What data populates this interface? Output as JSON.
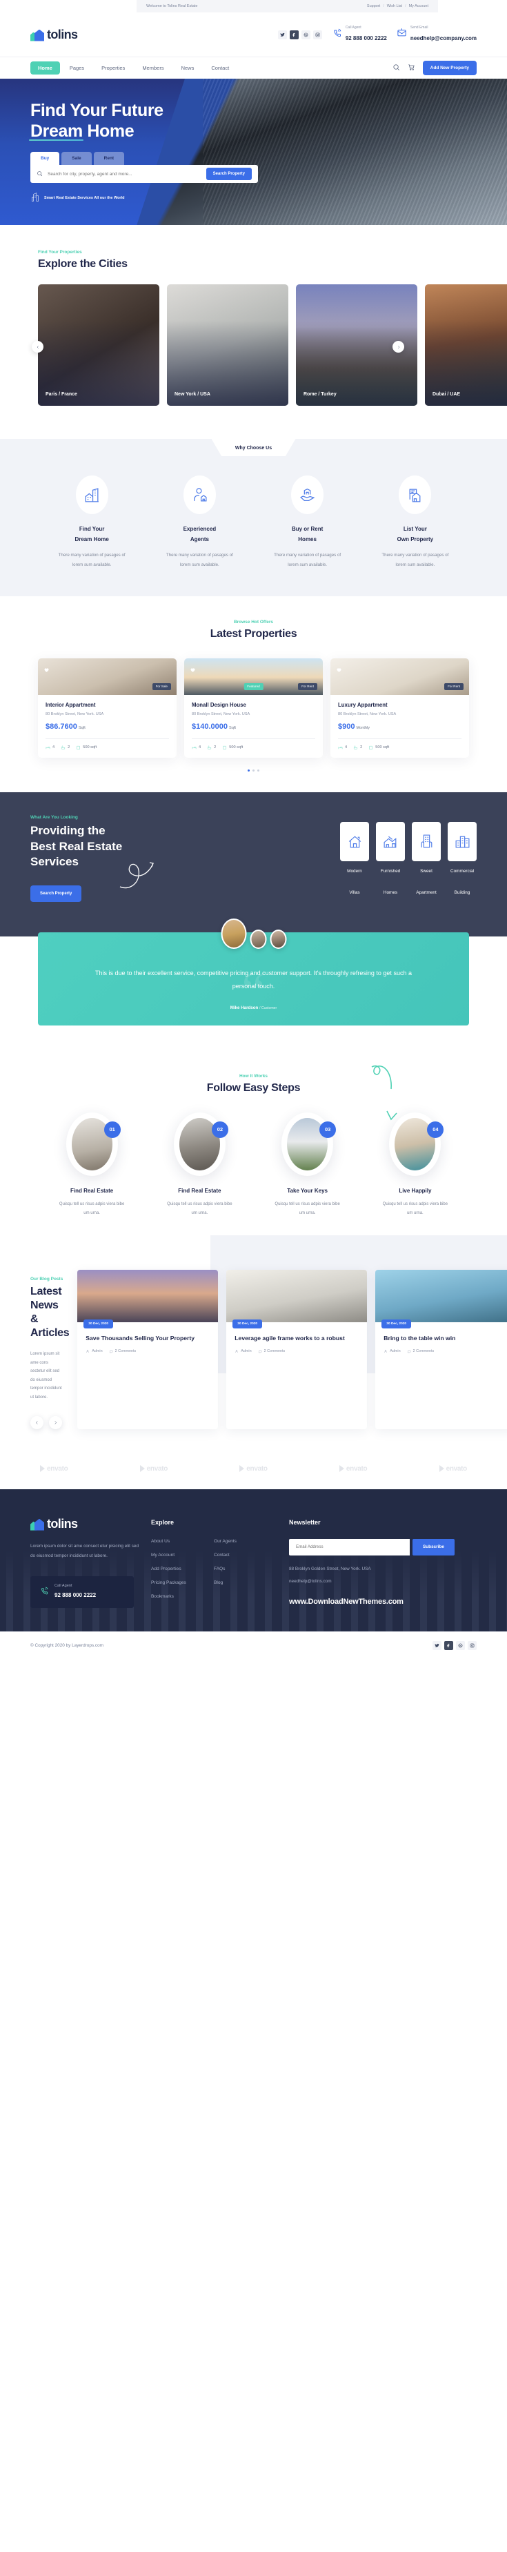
{
  "topbar": {
    "welcome": "Welcome to Tolins Real Estate",
    "links": [
      "Support",
      "Wish List",
      "My Account"
    ],
    "separator": "/"
  },
  "brand": {
    "name": "tolins"
  },
  "header": {
    "socials": [
      "twitter-icon",
      "facebook-icon",
      "dribbble-icon",
      "instagram-icon"
    ],
    "call": {
      "label": "Call Agent",
      "value": "92 888 000 2222"
    },
    "email": {
      "label": "Send Email",
      "value": "needhelp@company.com"
    }
  },
  "nav": {
    "items": [
      "Home",
      "Pages",
      "Properties",
      "Members",
      "News",
      "Contact"
    ],
    "active": "Home",
    "cta": "Add New Property"
  },
  "hero": {
    "title_line1": "Find Your Future",
    "title_line2_underlined": "Dream",
    "title_line2_rest": " Home",
    "tabs": [
      "Buy",
      "Sale",
      "Rent"
    ],
    "active_tab": "Buy",
    "search_placeholder": "Search for city, property, agent and more...",
    "search_button": "Search Property",
    "footnote": "Smart Real Estate Services All our the World"
  },
  "cities": {
    "sub": "Find Your Properties",
    "title": "Explore the Cities",
    "items": [
      {
        "label": "Paris / France"
      },
      {
        "label": "New York / USA"
      },
      {
        "label": "Rome / Turkey"
      },
      {
        "label": "Dubai / UAE"
      }
    ]
  },
  "why": {
    "tag": "Why Choose Us",
    "items": [
      {
        "icon": "buildings-icon",
        "line1": "Find Your",
        "line2": "Dream Home",
        "text": "There many variation of pasages of lorem sum available."
      },
      {
        "icon": "agent-icon",
        "line1": "Experienced",
        "line2": "Agents",
        "text": "There many variation of pasages of lorem sum available."
      },
      {
        "icon": "hand-home-icon",
        "line1": "Buy or Rent",
        "line2": "Homes",
        "text": "There many variation of pasages of lorem sum available."
      },
      {
        "icon": "listing-icon",
        "line1": "List Your",
        "line2": "Own Property",
        "text": "There many variation of pasages of lorem sum available."
      }
    ]
  },
  "properties": {
    "sub": "Browse Hot Offers",
    "title": "Latest Properties",
    "items": [
      {
        "title": "Interior Appartment",
        "address": "80 Broklyn Street, New York. USA",
        "price": "$86.7600",
        "unit": "Sqft",
        "beds": "4",
        "baths": "2",
        "area": "500 sqft",
        "tag": "For Sale",
        "tag_style": "dark"
      },
      {
        "title": "Monall Design House",
        "address": "80 Broklyn Street, New York. USA",
        "price": "$140.0000",
        "unit": "Sqft",
        "beds": "4",
        "baths": "2",
        "area": "500 sqft",
        "tag": "Featured",
        "tag_style": "teal",
        "tag2": "For Rent"
      },
      {
        "title": "Luxury Appartment",
        "address": "80 Broklyn Street, New York. USA",
        "price": "$900",
        "unit": "Monthly",
        "beds": "4",
        "baths": "2",
        "area": "500 sqft",
        "tag": "For Rent",
        "tag_style": "dark"
      }
    ],
    "dots": 3,
    "active_dot": 0
  },
  "services": {
    "sub": "What Are You Looking",
    "title_line1": "Providing the",
    "title_line2": "Best Real Estate",
    "title_line3": "Services",
    "button": "Search Property",
    "cards": [
      {
        "icon": "villa-icon",
        "line1": "Modern",
        "line2": "Villas"
      },
      {
        "icon": "house-icon",
        "line1": "Furnished",
        "line2": "Homes"
      },
      {
        "icon": "apartment-icon",
        "line1": "Sweet",
        "line2": "Apartment"
      },
      {
        "icon": "city-icon",
        "line1": "Commercial",
        "line2": "Building"
      }
    ]
  },
  "testimonial": {
    "quote": "This is due to their excellent service, competitive pricing and customer support. It's throughly refresing to get such a personal touch.",
    "author": "Mike Hardson",
    "role": "/ Customer"
  },
  "steps": {
    "sub": "How It Works",
    "title": "Follow Easy Steps",
    "items": [
      {
        "number": "01",
        "title": "Find Real Estate",
        "text": "Quisqu tell us risus adpis viera bibe um urna."
      },
      {
        "number": "02",
        "title": "Find Real Estate",
        "text": "Quisqu tell us risus adpis viera bibe um urna."
      },
      {
        "number": "03",
        "title": "Take Your Keys",
        "text": "Quisqu tell us risus adpis viera bibe um urna."
      },
      {
        "number": "04",
        "title": "Live Happily",
        "text": "Quisqu tell us risus adpis viera bibe um urna."
      }
    ]
  },
  "blog": {
    "sub": "Our Blog Posts",
    "title_line1": "Latest News",
    "title_line2": "& Articles",
    "text": "Lorem ipsum sit ame cons sectetur elit sed do eiusmod tempor incididunt ut labore.",
    "posts": [
      {
        "date": "30 Dec, 2020",
        "title": "Save Thousands Selling Your Property",
        "author": "Admin",
        "comments": "2 Comments"
      },
      {
        "date": "30 Dec, 2020",
        "title": "Leverage agile frame works to a robust",
        "author": "Admin",
        "comments": "2 Comments"
      },
      {
        "date": "30 Dec, 2020",
        "title": "Bring to the table win win",
        "author": "Admin",
        "comments": "2 Comments"
      }
    ]
  },
  "brands": {
    "count": 5,
    "label": "envato"
  },
  "footer": {
    "about": "Lorem ipsum dolor sit ame consect etur pisicing elit sed do eiusmod tempor incididunt ut labore.",
    "call": {
      "label": "Call Agent",
      "value": "92 888 000 2222"
    },
    "explore_heading": "Explore",
    "explore_col1": [
      "About Us",
      "My Account",
      "Add Properties",
      "Pricing Packages",
      "Bookmarks"
    ],
    "explore_col2": [
      "Our Agents",
      "Contact",
      "FAQs",
      "Blog"
    ],
    "newsletter_heading": "Newsletter",
    "email_placeholder": "Email Address",
    "subscribe": "Subscribe",
    "address": "88 Broklyn Golden Street, New York. USA",
    "email": "needhelp@tolins.com",
    "watermark": "www.DownloadNewThemes.com",
    "copyright": "© Copyright 2020 by Layerdrops.com",
    "socials": [
      "twitter-icon",
      "facebook-icon",
      "dribbble-icon",
      "instagram-icon"
    ]
  }
}
